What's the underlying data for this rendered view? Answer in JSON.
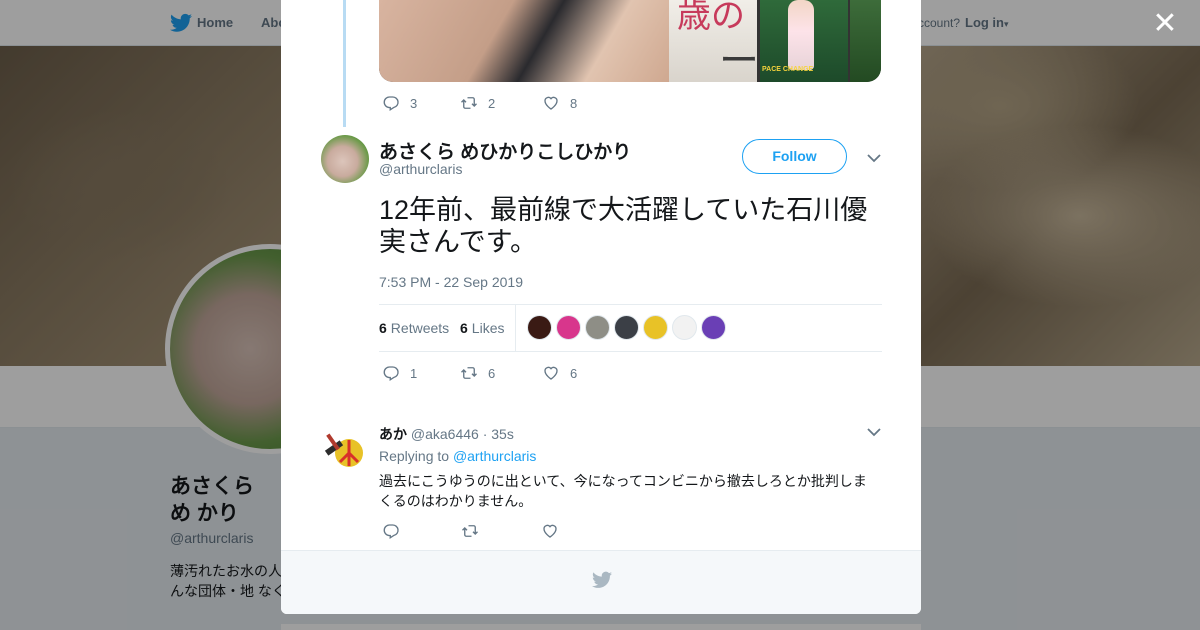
{
  "nav": {
    "home_label": "Home",
    "about_label": "Abo",
    "have_account": "ccount?",
    "login_label": "Log in"
  },
  "background_profile": {
    "name": "あさくら め かり",
    "handle": "@arthurclaris",
    "bio": "薄汚れたお水の人 てで引っ越した頭 はどんな団体・地 なく、ンデモさ"
  },
  "close_label": "✕",
  "prev_tweet": {
    "reply_count": "3",
    "retweet_count": "2",
    "like_count": "8"
  },
  "media": {
    "kanji_top": "歳の",
    "kanji_side": "ーショ",
    "caption": "PACE CHANGE"
  },
  "tweet": {
    "author_name": "あさくら めひかりこしひかり",
    "author_handle": "@arthurclaris",
    "follow_label": "Follow",
    "text": "12年前、最前線で大活躍していた石川優実さんです。",
    "timestamp": "7:53 PM - 22 Sep 2019",
    "retweets_count": "6",
    "retweets_label": "Retweets",
    "likes_count": "6",
    "likes_label": "Likes",
    "reply_count": "1",
    "retweet_count": "6",
    "like_count": "6",
    "likers": [
      "#3a1a14",
      "#d8368c",
      "#8e8e86",
      "#3b3f46",
      "#e8c227",
      "#f2f2f2",
      "#6a3fb5"
    ]
  },
  "reply": {
    "author_name": "あか",
    "author_handle": "@aka6446",
    "time": "· 35s",
    "replying_prefix": "Replying to",
    "replying_to": "@arthurclaris",
    "text": "過去にこうゆうのに出といて、今になってコンビニから撤去しろとか批判しまくるのはわかりません。"
  },
  "colors": {
    "accent": "#1da1f2",
    "muted": "#657786",
    "text": "#14171a"
  }
}
